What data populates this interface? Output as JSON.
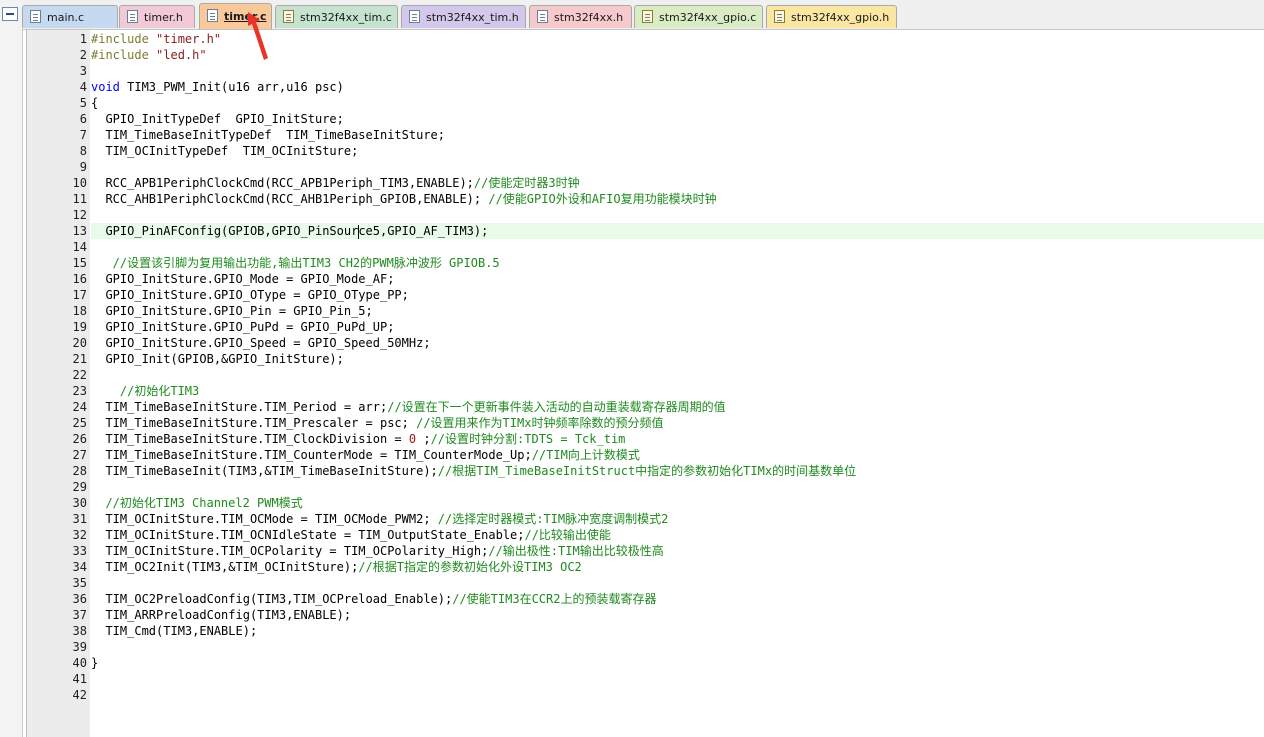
{
  "tabs": [
    {
      "label": "main.c",
      "color": "#c5d9f1",
      "icon": "document-icon"
    },
    {
      "label": "timer.h",
      "color": "#f2c9d6",
      "icon": "document-icon"
    },
    {
      "label": "timer.c",
      "color": "#f9c99b",
      "icon": "document-icon",
      "active": true
    },
    {
      "label": "stm32f4xx_tim.c",
      "color": "#c6e3d0",
      "icon": "library-file-icon"
    },
    {
      "label": "stm32f4xx_tim.h",
      "color": "#d3c7ec",
      "icon": "document-icon"
    },
    {
      "label": "stm32f4xx.h",
      "color": "#f6c9cc",
      "icon": "document-icon"
    },
    {
      "label": "stm32f4xx_gpio.c",
      "color": "#d9ecc4",
      "icon": "library-file-icon"
    },
    {
      "label": "stm32f4xx_gpio.h",
      "color": "#fbe7a1",
      "icon": "library-file-icon"
    }
  ],
  "editor": {
    "highlight_line": 13,
    "highlight_color": "#e8fbe8",
    "lines": [
      [
        {
          "t": "#include ",
          "c": "pp"
        },
        {
          "t": "\"timer.h\"",
          "c": "str"
        }
      ],
      [
        {
          "t": "#include ",
          "c": "pp"
        },
        {
          "t": "\"led.h\"",
          "c": "str"
        }
      ],
      [],
      [
        {
          "t": "void",
          "c": "kw"
        },
        {
          "t": " TIM3_PWM_Init(u16 arr,u16 psc)"
        }
      ],
      [
        {
          "t": "{"
        }
      ],
      [
        {
          "t": "  GPIO_InitTypeDef  GPIO_InitSture;"
        }
      ],
      [
        {
          "t": "  TIM_TimeBaseInitTypeDef  TIM_TimeBaseInitSture;"
        }
      ],
      [
        {
          "t": "  TIM_OCInitTypeDef  TIM_OCInitSture;"
        }
      ],
      [],
      [
        {
          "t": "  RCC_APB1PeriphClockCmd(RCC_APB1Periph_TIM3,ENABLE);"
        },
        {
          "t": "//使能定时器3时钟",
          "c": "cmt"
        }
      ],
      [
        {
          "t": "  RCC_AHB1PeriphClockCmd(RCC_AHB1Periph_GPIOB,ENABLE); "
        },
        {
          "t": "//使能GPIO外设和AFIO复用功能模块时钟",
          "c": "cmt"
        }
      ],
      [],
      [
        {
          "t": "  GPIO_PinAFConfig(GPIOB,GPIO_PinSour"
        },
        {
          "caret": true
        },
        {
          "t": "ce5,GPIO_AF_TIM3);"
        }
      ],
      [],
      [
        {
          "t": "   //设置该引脚为复用输出功能,输出TIM3 CH2的PWM脉冲波形 GPIOB.5",
          "c": "cmt"
        }
      ],
      [
        {
          "t": "  GPIO_InitSture.GPIO_Mode = GPIO_Mode_AF;"
        }
      ],
      [
        {
          "t": "  GPIO_InitSture.GPIO_OType = GPIO_OType_PP;"
        }
      ],
      [
        {
          "t": "  GPIO_InitSture.GPIO_Pin = GPIO_Pin_5;"
        }
      ],
      [
        {
          "t": "  GPIO_InitSture.GPIO_PuPd = GPIO_PuPd_UP;"
        }
      ],
      [
        {
          "t": "  GPIO_InitSture.GPIO_Speed = GPIO_Speed_50MHz;"
        }
      ],
      [
        {
          "t": "  GPIO_Init(GPIOB,&GPIO_InitSture);"
        }
      ],
      [],
      [
        {
          "t": "    //初始化TIM3",
          "c": "cmt"
        }
      ],
      [
        {
          "t": "  TIM_TimeBaseInitSture.TIM_Period = arr;"
        },
        {
          "t": "//设置在下一个更新事件装入活动的自动重装载寄存器周期的值",
          "c": "cmt"
        }
      ],
      [
        {
          "t": "  TIM_TimeBaseInitSture.TIM_Prescaler = psc; "
        },
        {
          "t": "//设置用来作为TIMx时钟频率除数的预分频值",
          "c": "cmt"
        }
      ],
      [
        {
          "t": "  TIM_TimeBaseInitSture.TIM_ClockDivision = "
        },
        {
          "t": "0",
          "c": "str"
        },
        {
          "t": " ;"
        },
        {
          "t": "//设置时钟分割:TDTS = Tck_tim",
          "c": "cmt"
        }
      ],
      [
        {
          "t": "  TIM_TimeBaseInitSture.TIM_CounterMode = TIM_CounterMode_Up;"
        },
        {
          "t": "//TIM向上计数模式",
          "c": "cmt"
        }
      ],
      [
        {
          "t": "  TIM_TimeBaseInit(TIM3,&TIM_TimeBaseInitSture);"
        },
        {
          "t": "//根据TIM_TimeBaseInitStruct中指定的参数初始化TIMx的时间基数单位",
          "c": "cmt"
        }
      ],
      [],
      [
        {
          "t": "  //初始化TIM3 Channel2 PWM模式",
          "c": "cmt"
        }
      ],
      [
        {
          "t": "  TIM_OCInitSture.TIM_OCMode = TIM_OCMode_PWM2; "
        },
        {
          "t": "//选择定时器模式:TIM脉冲宽度调制模式2",
          "c": "cmt"
        }
      ],
      [
        {
          "t": "  TIM_OCInitSture.TIM_OCNIdleState = TIM_OutputState_Enable;"
        },
        {
          "t": "//比较输出使能",
          "c": "cmt"
        }
      ],
      [
        {
          "t": "  TIM_OCInitSture.TIM_OCPolarity = TIM_OCPolarity_High;"
        },
        {
          "t": "//输出极性:TIM输出比较极性高",
          "c": "cmt"
        }
      ],
      [
        {
          "t": "  TIM_OC2Init(TIM3,&TIM_OCInitSture);"
        },
        {
          "t": "//根据T指定的参数初始化外设TIM3 OC2",
          "c": "cmt"
        }
      ],
      [],
      [
        {
          "t": "  TIM_OC2PreloadConfig(TIM3,TIM_OCPreload_Enable);"
        },
        {
          "t": "//使能TIM3在CCR2上的预装载寄存器",
          "c": "cmt"
        }
      ],
      [
        {
          "t": "  TIM_ARRPreloadConfig(TIM3,ENABLE);"
        }
      ],
      [
        {
          "t": "  TIM_Cmd(TIM3,ENABLE);"
        }
      ],
      [],
      [
        {
          "t": "}"
        }
      ],
      [],
      []
    ]
  }
}
